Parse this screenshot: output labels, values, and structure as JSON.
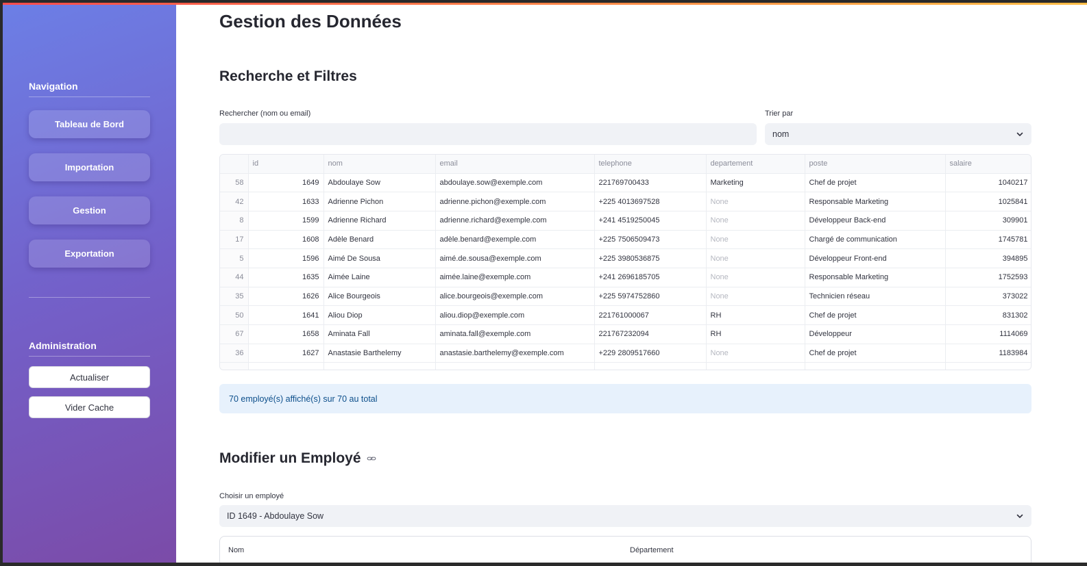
{
  "sidebar": {
    "navigation_heading": "Navigation",
    "nav_items": [
      "Tableau de Bord",
      "Importation",
      "Gestion",
      "Exportation"
    ],
    "admin_heading": "Administration",
    "admin_buttons": [
      "Actualiser",
      "Vider Cache"
    ]
  },
  "main": {
    "title": "Gestion des Données",
    "search_section_title": "Recherche et Filtres",
    "search_label": "Rechercher (nom ou email)",
    "search_value": "",
    "sort_label": "Trier par",
    "sort_value": "nom",
    "table": {
      "columns": [
        "",
        "id",
        "nom",
        "email",
        "telephone",
        "departement",
        "poste",
        "salaire"
      ],
      "rows": [
        [
          "58",
          "1649",
          "Abdoulaye Sow",
          "abdoulaye.sow@exemple.com",
          "221769700433",
          "Marketing",
          "Chef de projet",
          "1040217"
        ],
        [
          "42",
          "1633",
          "Adrienne Pichon",
          "adrienne.pichon@exemple.com",
          "+225 4013697528",
          "None",
          "Responsable Marketing",
          "1025841"
        ],
        [
          "8",
          "1599",
          "Adrienne Richard",
          "adrienne.richard@exemple.com",
          "+241 4519250045",
          "None",
          "Développeur Back-end",
          "309901"
        ],
        [
          "17",
          "1608",
          "Adèle Benard",
          "adèle.benard@exemple.com",
          "+225 7506509473",
          "None",
          "Chargé de communication",
          "1745781"
        ],
        [
          "5",
          "1596",
          "Aimé De Sousa",
          "aimé.de.sousa@exemple.com",
          "+225 3980536875",
          "None",
          "Développeur Front-end",
          "394895"
        ],
        [
          "44",
          "1635",
          "Aimée Laine",
          "aimée.laine@exemple.com",
          "+241 2696185705",
          "None",
          "Responsable Marketing",
          "1752593"
        ],
        [
          "35",
          "1626",
          "Alice Bourgeois",
          "alice.bourgeois@exemple.com",
          "+225 5974752860",
          "None",
          "Technicien réseau",
          "373022"
        ],
        [
          "50",
          "1641",
          "Aliou Diop",
          "aliou.diop@exemple.com",
          "221761000067",
          "RH",
          "Chef de projet",
          "831302"
        ],
        [
          "67",
          "1658",
          "Aminata Fall",
          "aminata.fall@exemple.com",
          "221767232094",
          "RH",
          "Développeur",
          "1114069"
        ],
        [
          "36",
          "1627",
          "Anastasie Barthelemy",
          "anastasie.barthelemy@exemple.com",
          "+229 2809517660",
          "None",
          "Chef de projet",
          "1183984"
        ],
        [
          "",
          "",
          "",
          "",
          "",
          "",
          "",
          ""
        ]
      ]
    },
    "info_text": "70 employé(s) affiché(s) sur 70 au total",
    "edit_section_title": "Modifier un Employé",
    "choose_label": "Choisir un employé",
    "choose_value": "ID 1649 - Abdoulaye Sow",
    "form_label_nom": "Nom",
    "form_label_departement": "Département"
  },
  "icons": {
    "select_chevron": "chevron-down-icon",
    "heading_anchor": "link-icon"
  },
  "colors": {
    "sidebar_start": "#6c7fe6",
    "sidebar_end": "#7b4ba8",
    "info_bg": "#e7f1fc",
    "info_text": "#0d4f8b"
  }
}
